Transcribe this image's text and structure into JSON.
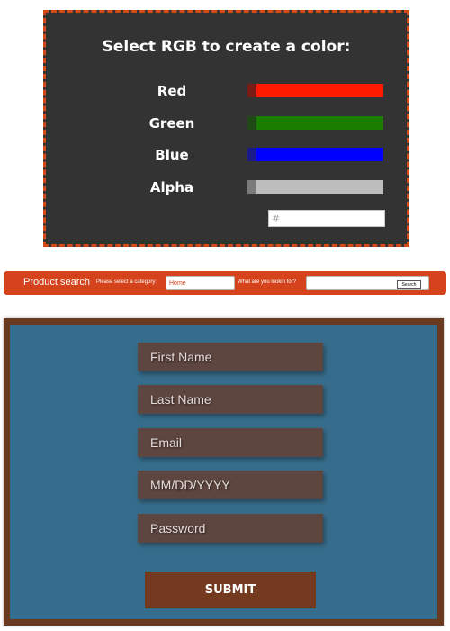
{
  "rgb_picker": {
    "title": "Select RGB to create a color:",
    "sliders": [
      {
        "label": "Red",
        "color": "#ff1a00",
        "thumb_color": "#7a1c14",
        "value": 0
      },
      {
        "label": "Green",
        "color": "#1a7d00",
        "thumb_color": "#1f4a17",
        "value": 0
      },
      {
        "label": "Blue",
        "color": "#0000ff",
        "thumb_color": "#1a1a8a",
        "value": 0
      },
      {
        "label": "Alpha",
        "color": "#bdbdbd",
        "thumb_color": "#7b7b7b",
        "value": 0
      }
    ],
    "hex_placeholder": "#",
    "accent": "#d24a16"
  },
  "product_search": {
    "title": "Product search",
    "category_prompt": "Please select a category:",
    "category_placeholder": "Home",
    "query_prompt": "What are you lookin for?",
    "query_placeholder": "",
    "button_label": "Search",
    "bar_color": "#d4431b"
  },
  "signup_form": {
    "fields": [
      {
        "placeholder": "First Name"
      },
      {
        "placeholder": "Last Name"
      },
      {
        "placeholder": "Email"
      },
      {
        "placeholder": "MM/DD/YYYY"
      },
      {
        "placeholder": "Password"
      }
    ],
    "submit_label": "SUBMIT",
    "panel_color": "#376d8c",
    "border_color": "#6a3a20"
  }
}
